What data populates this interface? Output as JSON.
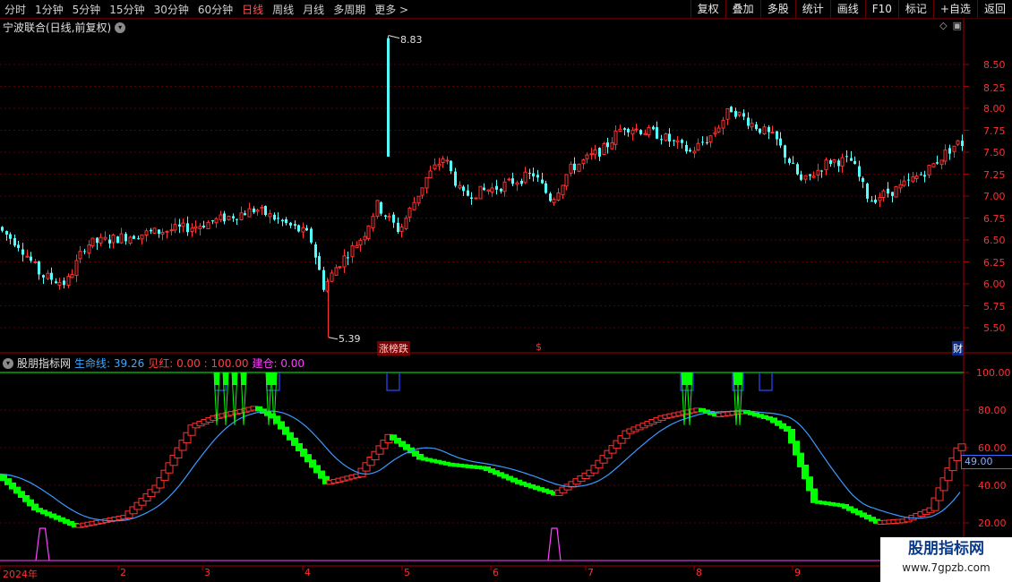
{
  "toolbar": {
    "periods": [
      "分时",
      "1分钟",
      "5分钟",
      "15分钟",
      "30分钟",
      "60分钟",
      "日线",
      "周线",
      "月线",
      "多周期",
      "更多 >"
    ],
    "active_period": "日线",
    "right_buttons": [
      "复权",
      "叠加",
      "多股",
      "统计",
      "画线",
      "F10",
      "标记",
      "+自选",
      "返回"
    ]
  },
  "main_chart": {
    "title": "宁波联合(日线,前复权)",
    "high_label": "8.83",
    "low_label": "5.39",
    "y_ticks": [
      "8.50",
      "8.25",
      "8.00",
      "7.75",
      "7.50",
      "7.25",
      "7.00",
      "6.75",
      "6.50",
      "6.25",
      "6.00",
      "5.75",
      "5.50"
    ],
    "markers": {
      "zb": "涨榜跌",
      "dollar": "$",
      "cai": "财"
    }
  },
  "indicator": {
    "name": "股朋指标网",
    "life_line": "生命线: 39.26",
    "jianhong": "见红: 0.00 : 100.00",
    "jiancang": "建仓: 0.00",
    "y_ticks": [
      "100.00",
      "80.00",
      "60.00",
      "40.00",
      "20.00"
    ],
    "current_value": "49.00"
  },
  "x_axis": {
    "labels": [
      "2024年",
      "2",
      "3",
      "4",
      "5",
      "6",
      "7",
      "8",
      "9"
    ]
  },
  "watermark": {
    "line1": "股朋指标网",
    "line2": "www.7gpzb.com"
  },
  "colors": {
    "up": "#ff3232",
    "down": "#54ffff",
    "life": "#3a9aff",
    "green": "#00ff00",
    "magenta": "#ff40ff",
    "blue": "#2a4aff"
  }
}
